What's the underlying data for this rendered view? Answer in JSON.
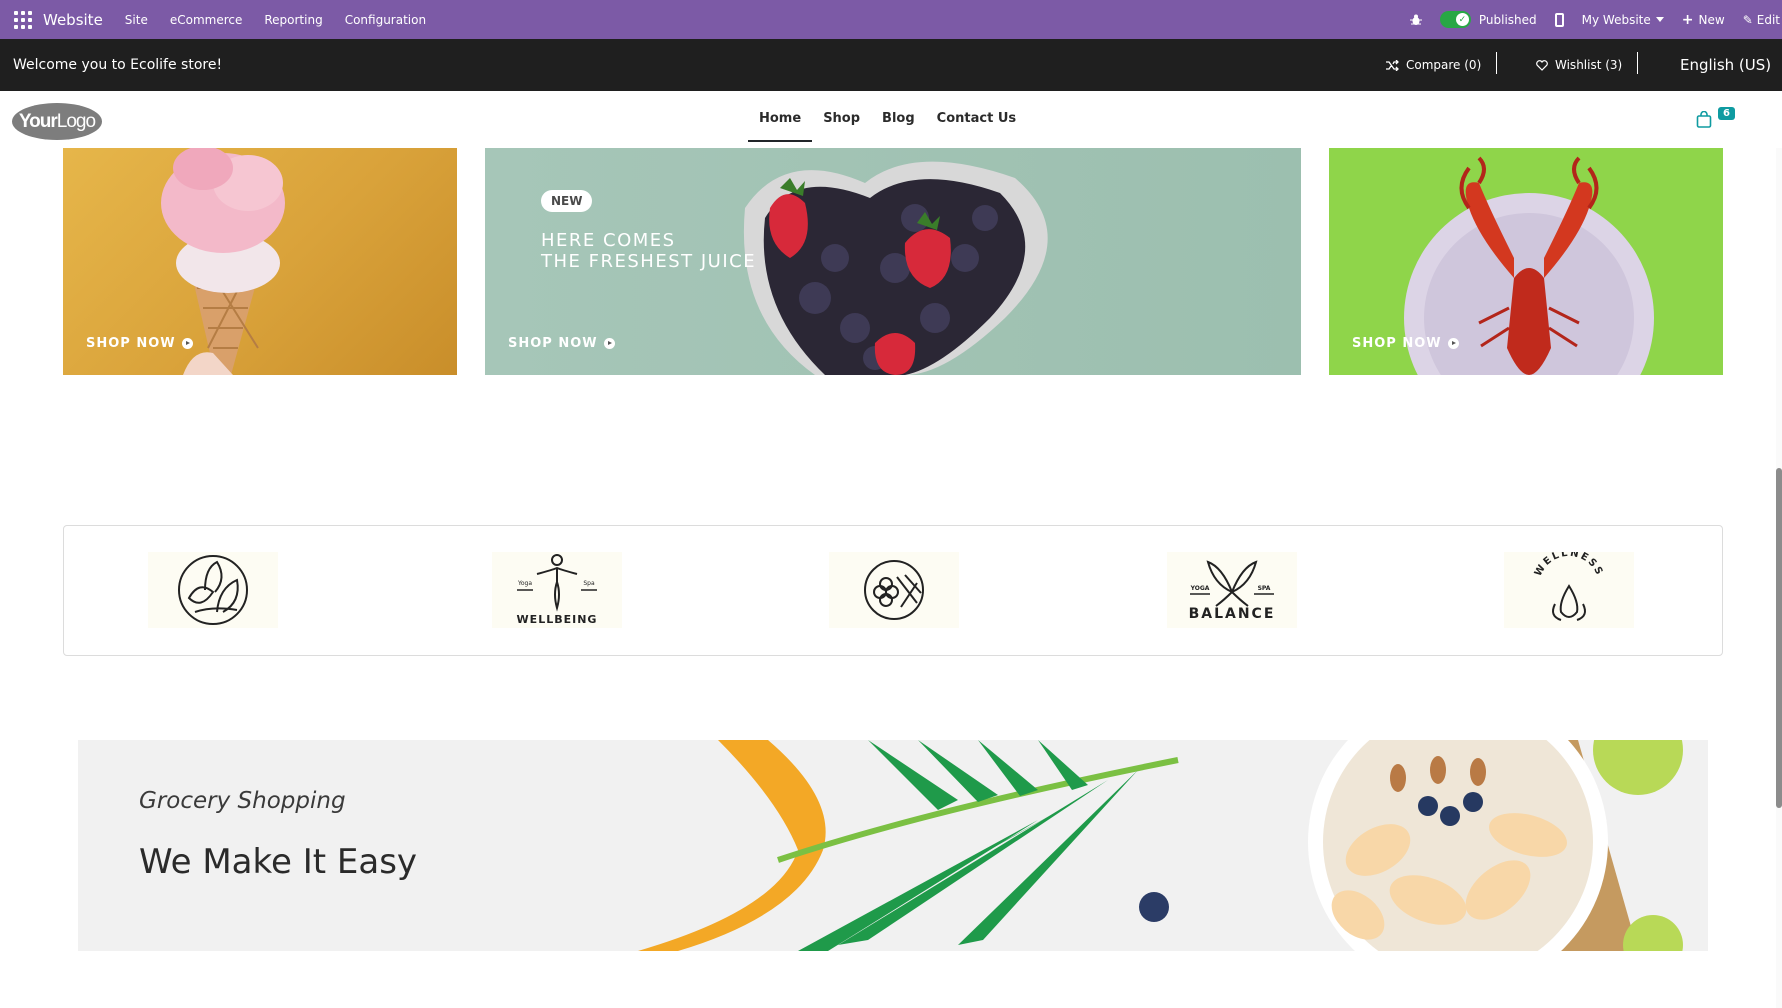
{
  "admin_bar": {
    "app_name": "Website",
    "menus": [
      "Site",
      "eCommerce",
      "Reporting",
      "Configuration"
    ],
    "published_label": "Published",
    "website_label": "My Website",
    "new_label": "New",
    "edit_label": "Edit",
    "accent_color": "#7c5aa6"
  },
  "top_strip": {
    "welcome": "Welcome you to Ecolife store!",
    "compare": "Compare (0)",
    "wishlist": "Wishlist (3)",
    "language": "English (US)"
  },
  "header": {
    "logo_bold": "Your",
    "logo_thin": "Logo",
    "nav": [
      "Home",
      "Shop",
      "Blog",
      "Contact Us"
    ],
    "active_nav": "Home",
    "cart_count": "6"
  },
  "banners": {
    "left_cta": "SHOP NOW",
    "middle_badge": "NEW",
    "middle_title_1": "HERE COMES",
    "middle_title_2": "THE FRESHEST JUICE",
    "middle_cta": "SHOP NOW",
    "right_cta": "SHOP NOW"
  },
  "brands": {
    "wellbeing": "WELLBEING",
    "wellbeing_left": "Yoga",
    "wellbeing_right": "Spa",
    "balance": "BALANCE",
    "balance_left": "YOGA",
    "balance_right": "SPA",
    "wellness": "WELLNESS"
  },
  "grocery": {
    "subtitle": "Grocery Shopping",
    "headline": "We Make It Easy"
  }
}
